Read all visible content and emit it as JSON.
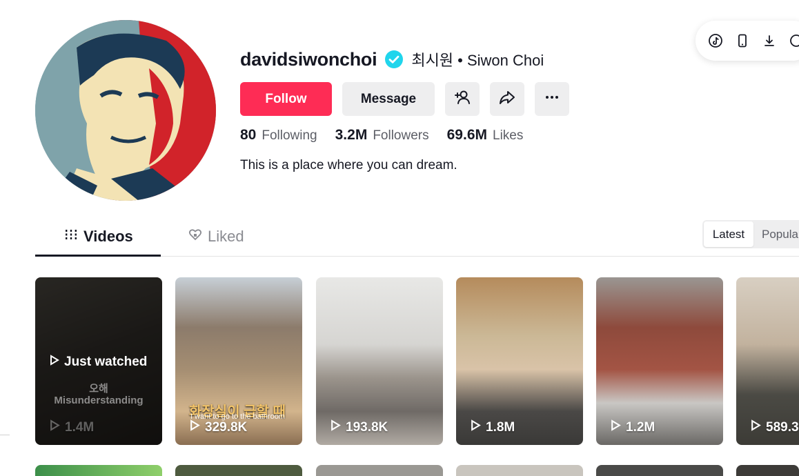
{
  "profile": {
    "username": "davidsiwonchoi",
    "nickname": "최시원 • Siwon Choi",
    "bio": "This is a place where you can dream.",
    "verified_icon": "verified-badge-icon"
  },
  "actions": {
    "follow_label": "Follow",
    "message_label": "Message",
    "add_friend_icon": "add-friend-icon",
    "share_icon": "share-icon",
    "more_icon": "more-icon"
  },
  "stats": [
    {
      "value": "80",
      "label": "Following"
    },
    {
      "value": "3.2M",
      "label": "Followers"
    },
    {
      "value": "69.6M",
      "label": "Likes"
    }
  ],
  "toolbar": {
    "icons": [
      "tiktok-icon",
      "mobile-icon",
      "download-icon"
    ]
  },
  "tabs": [
    {
      "label": "Videos",
      "icon": "grid-icon",
      "active": true
    },
    {
      "label": "Liked",
      "icon": "liked-heart-icon",
      "active": false
    }
  ],
  "sort": {
    "options": [
      "Latest",
      "Popular"
    ],
    "selected": "Latest",
    "visible_inactive": "Popula"
  },
  "videos": [
    {
      "views": "1.4M",
      "overlay": "Just watched",
      "caption": "오해",
      "caption2": "Misunderstanding"
    },
    {
      "views": "329.8K",
      "caption": "화장실이 급할 때",
      "caption2": "I want to go to the bathroom"
    },
    {
      "views": "193.8K"
    },
    {
      "views": "1.8M"
    },
    {
      "views": "1.2M"
    },
    {
      "views": "589.3"
    }
  ],
  "colors": {
    "accent": "#fe2c55",
    "verified": "#20d5ec",
    "text": "#161823",
    "muted": "#5c5e66",
    "button_bg": "#eeeeef"
  }
}
